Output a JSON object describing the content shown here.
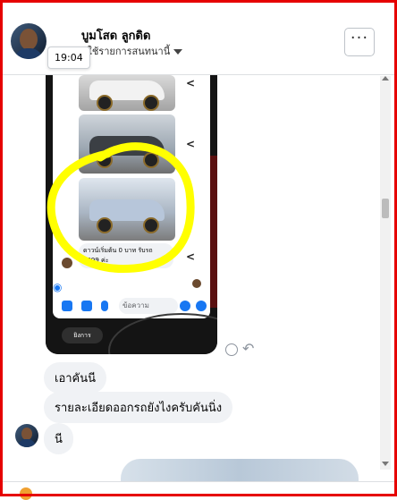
{
  "header": {
    "name": "บูมโสด ลูกดิด",
    "subtitle": "ผู้ใช้รายการสนทนานี้",
    "time_tooltip": "19:04",
    "more_label": "···"
  },
  "screenshot": {
    "caption": "ดาวน์เริ่มต้น 0 บาท รับรถ 1999 ค่ะ",
    "composer_placeholder": "ข้อความ",
    "pill_label": "ยิงการ"
  },
  "messages": [
    {
      "text": "เอาคันนี"
    },
    {
      "text": "รายละเอียดออกรถยังไงครับคันนิ่ง"
    },
    {
      "text": "นี"
    }
  ],
  "colors": {
    "frame": "#e60000",
    "highlight": "#ffff00",
    "bubble": "#f0f2f5",
    "accent": "#1877f2"
  }
}
